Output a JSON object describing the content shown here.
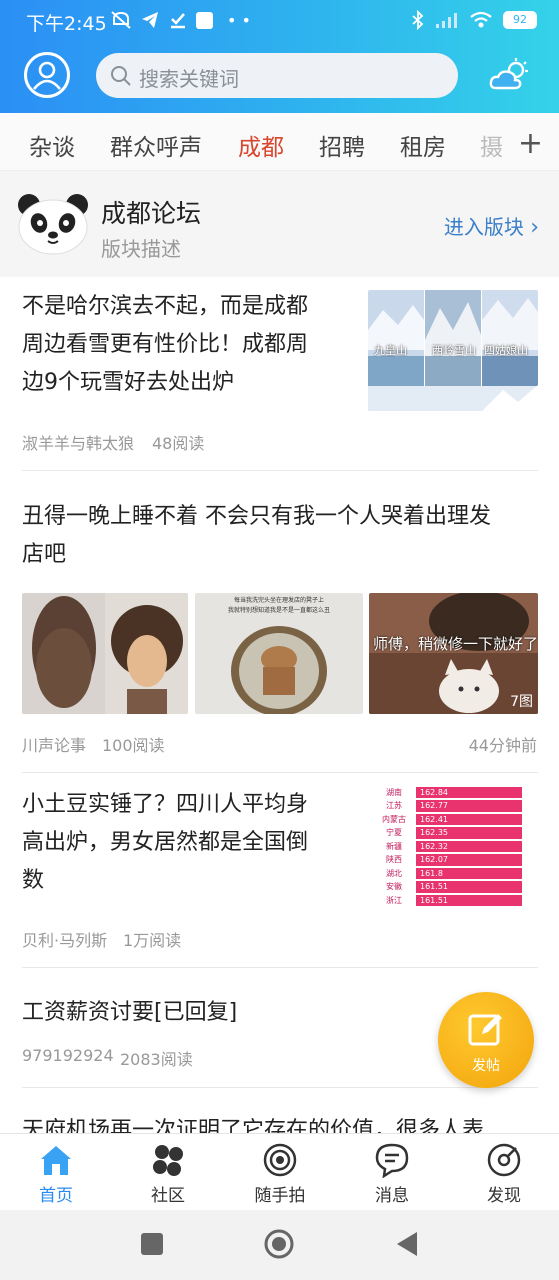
{
  "status_bar": {
    "time": "下午2:45",
    "battery": "92"
  },
  "search": {
    "placeholder": "搜索关键词"
  },
  "tabs": [
    "杂谈",
    "群众呼声",
    "成都",
    "招聘",
    "租房",
    "摄"
  ],
  "active_tab": "成都",
  "forum": {
    "name": "成都论坛",
    "description": "版块描述",
    "enter_label": "进入版块"
  },
  "posts": [
    {
      "title_lines": [
        "不是哈尔滨去不起，而是成都",
        "周边看雪更有性价比！成都周",
        "边9个玩雪好去处出炉"
      ],
      "author": "淑羊羊与韩太狼",
      "reads": "48阅读",
      "image_labels": [
        "九皇山",
        "西岭雪山",
        "四姑娘山"
      ]
    },
    {
      "title_lines": [
        "丑得一晚上睡不着 不会只有我一个人哭着出理发",
        "店吧"
      ],
      "author": "川声论事",
      "reads": "100阅读",
      "time": "44分钟前",
      "image_count": "7图",
      "image_captions": [
        "师傅，稍微修一下就好了",
        "每当我洗完头坐在理发店的凳子上",
        "我就特别想知道我是不是一直都这么丑"
      ]
    },
    {
      "title_lines": [
        "小土豆实锤了？四川人平均身",
        "高出炉，男女居然都是全国倒",
        "数"
      ],
      "author": "贝利·马列斯",
      "reads": "1万阅读",
      "table_rows": [
        {
          "province": "湖南",
          "height": "162.84"
        },
        {
          "province": "江苏",
          "height": "162.77"
        },
        {
          "province": "内蒙古",
          "height": "162.41"
        },
        {
          "province": "宁夏",
          "height": "162.35"
        },
        {
          "province": "新疆",
          "height": "162.32"
        },
        {
          "province": "陕西",
          "height": "162.07"
        },
        {
          "province": "湖北",
          "height": "161.8"
        },
        {
          "province": "安徽",
          "height": "161.51"
        },
        {
          "province": "浙江",
          "height": "161.51"
        }
      ]
    },
    {
      "title_lines": [
        "工资薪资讨要[已回复]"
      ],
      "author": "979192924",
      "reads": "2083阅读"
    },
    {
      "title_lines": [
        "天府机场再一次证明了它存在的价值，很多人表"
      ]
    }
  ],
  "fab": {
    "label": "发帖"
  },
  "bottom_nav": [
    "首页",
    "社区",
    "随手拍",
    "消息",
    "发现"
  ],
  "colors": {
    "accent": "#2a8cf0",
    "active_tab": "#d8462e",
    "fab": "#f5b10f",
    "link": "#3a7fc9"
  }
}
